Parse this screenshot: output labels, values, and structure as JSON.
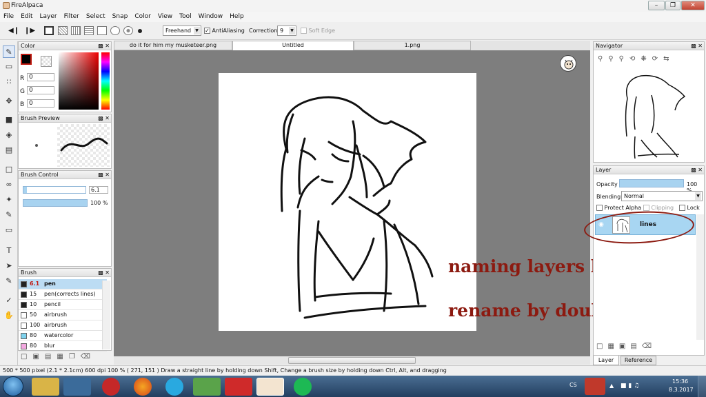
{
  "window": {
    "title": "FireAlpaca"
  },
  "menu": [
    "File",
    "Edit",
    "Layer",
    "Filter",
    "Select",
    "Snap",
    "Color",
    "View",
    "Tool",
    "Window",
    "Help"
  ],
  "toolbar": {
    "mode": "Freehand",
    "antialias_label": "AntiAliasing",
    "correction_label": "Correction",
    "correction_value": "9",
    "softedge_label": "Soft Edge"
  },
  "tabs": [
    "do it for him my musketeer.png",
    "Untitled",
    "1.png"
  ],
  "color_panel": {
    "title": "Color",
    "r_label": "R",
    "g_label": "G",
    "b_label": "B",
    "r": "0",
    "g": "0",
    "b": "0"
  },
  "brush_preview": {
    "title": "Brush Preview"
  },
  "brush_control": {
    "title": "Brush Control",
    "size": "6.1",
    "opacity": "100 %",
    "size_fraction": 0.05,
    "opacity_fraction": 1.0
  },
  "brush": {
    "title": "Brush",
    "items": [
      {
        "size": "6.1",
        "name": "pen",
        "color": "#222222",
        "selected": true
      },
      {
        "size": "15",
        "name": "pen(corrects lines)",
        "color": "#222222"
      },
      {
        "size": "10",
        "name": "pencil",
        "color": "#222222"
      },
      {
        "size": "50",
        "name": "airbrush",
        "color": "#ffffff"
      },
      {
        "size": "100",
        "name": "airbrush",
        "color": "#ffffff"
      },
      {
        "size": "80",
        "name": "watercolor",
        "color": "#7fd3ee"
      },
      {
        "size": "80",
        "name": "blur",
        "color": "#f3a8e0"
      }
    ]
  },
  "navigator": {
    "title": "Navigator"
  },
  "layer_panel": {
    "title": "Layer",
    "opacity_label": "Opacity",
    "opacity_value": "100 %",
    "blending_label": "Blending",
    "blending_value": "Normal",
    "protect_alpha": "Protect Alpha",
    "clipping": "Clipping",
    "lock": "Lock",
    "layer_name": "lines",
    "tab_layer": "Layer",
    "tab_reference": "Reference"
  },
  "annotations": {
    "line1": "naming layers helps a lot",
    "line2": "rename by double clicking"
  },
  "status": {
    "text": "500 * 500 pixel  (2.1 * 2.1cm)  600 dpi  100 %  ( 271, 151 )  Draw a straight line by holding down Shift, Change a brush size by holding down Ctrl, Alt, and dragging"
  },
  "taskbar": {
    "lang": "CS",
    "time": "15:36",
    "date": "8.3.2017"
  }
}
